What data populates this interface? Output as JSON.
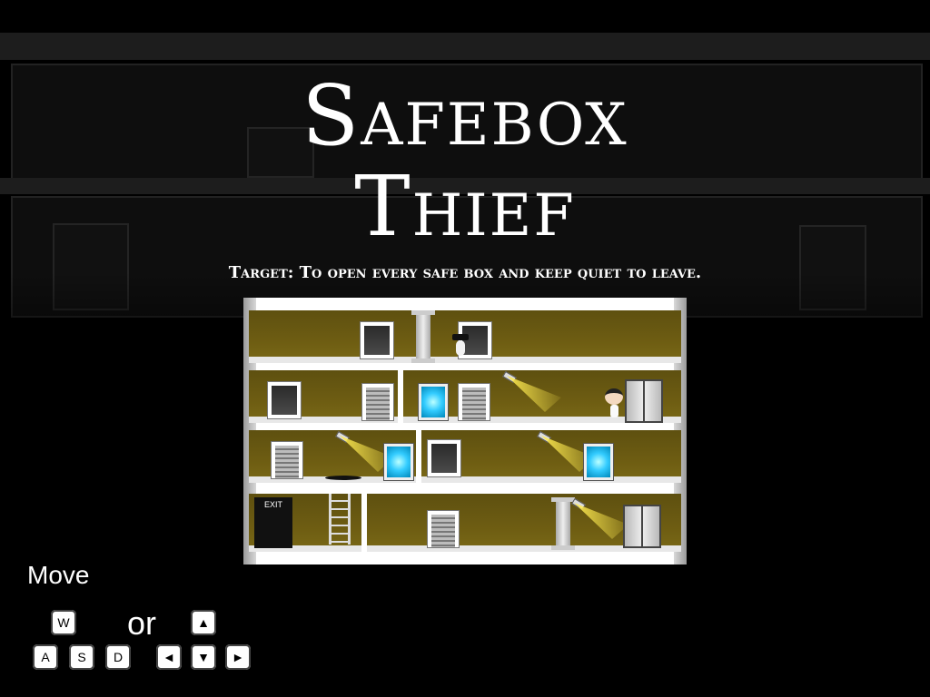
{
  "title": {
    "line1": "Safebox",
    "line2": "Thief"
  },
  "subtitle": "Target: To open every safe box and keep quiet to leave.",
  "preview": {
    "exit_label": "EXIT"
  },
  "controls": {
    "move_label": "Move",
    "or_label": "or",
    "keys": {
      "w": "W",
      "a": "A",
      "s": "S",
      "d": "D",
      "up": "▲",
      "left": "◄",
      "down": "▼",
      "right": "►"
    }
  },
  "colors": {
    "background": "#000000",
    "floor": "#6e5d12",
    "safe": "#33ccff",
    "light_beam": "#ffeb50"
  }
}
